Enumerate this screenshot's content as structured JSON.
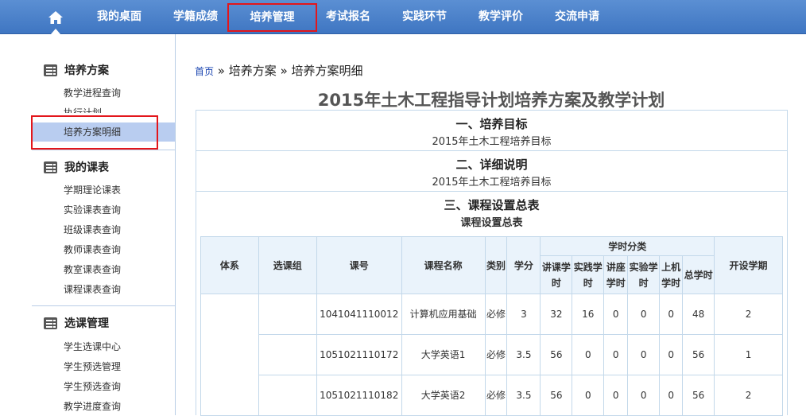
{
  "nav": {
    "items": [
      "我的桌面",
      "学籍成绩",
      "培养管理",
      "考试报名",
      "实践环节",
      "教学评价",
      "交流申请"
    ],
    "active": "培养管理"
  },
  "sidebar": {
    "groups": [
      {
        "title": "培养方案",
        "icon": "document-list-icon",
        "items": [
          "教学进程查询",
          "执行计划",
          "培养方案明细"
        ],
        "selected": "培养方案明细"
      },
      {
        "title": "我的课表",
        "icon": "document-list-icon",
        "items": [
          "学期理论课表",
          "实验课表查询",
          "班级课表查询",
          "教师课表查询",
          "教室课表查询",
          "课程课表查询"
        ]
      },
      {
        "title": "选课管理",
        "icon": "document-list-icon",
        "items": [
          "学生选课中心",
          "学生预选管理",
          "学生预选查询",
          "教学进度查询"
        ]
      }
    ]
  },
  "breadcrumb": {
    "home": "首页",
    "sep": "»",
    "level1": "培养方案",
    "level2": "培养方案明细"
  },
  "page_title": "2015年土木工程指导计划培养方案及教学计划",
  "sections": [
    {
      "heading": "一、培养目标",
      "text": "2015年土木工程培养目标"
    },
    {
      "heading": "二、详细说明",
      "text": "2015年土木工程培养目标"
    },
    {
      "heading": "三、课程设置总表",
      "text": "课程设置总表"
    }
  ],
  "table": {
    "headers": {
      "system": "体系",
      "group": "选课组",
      "code": "课号",
      "name": "课程名称",
      "category": "类别",
      "credit": "学分",
      "hours_group": "学时分类",
      "lecture": "讲课学时",
      "practice": "实践学时",
      "seminar": "讲座学时",
      "lab": "实验学时",
      "computer": "上机学时",
      "total": "总学时",
      "term": "开设学期"
    },
    "rows": [
      {
        "code": "1041041110012",
        "name": "计算机应用基础",
        "category": "必修",
        "credit": "3",
        "lecture": "32",
        "practice": "16",
        "seminar": "0",
        "lab": "0",
        "computer": "0",
        "total": "48",
        "term": "2"
      },
      {
        "code": "1051021110172",
        "name": "大学英语1",
        "category": "必修",
        "credit": "3.5",
        "lecture": "56",
        "practice": "0",
        "seminar": "0",
        "lab": "0",
        "computer": "0",
        "total": "56",
        "term": "1"
      },
      {
        "code": "1051021110182",
        "name": "大学英语2",
        "category": "必修",
        "credit": "3.5",
        "lecture": "56",
        "practice": "0",
        "seminar": "0",
        "lab": "0",
        "computer": "0",
        "total": "56",
        "term": "2"
      }
    ]
  },
  "colors": {
    "nav_bg": "#4a80c9",
    "highlight_red": "#e3161b",
    "selected_bg": "#b9cdf0",
    "table_border": "#c3d8ea",
    "table_header_bg": "#eaf3fb"
  }
}
